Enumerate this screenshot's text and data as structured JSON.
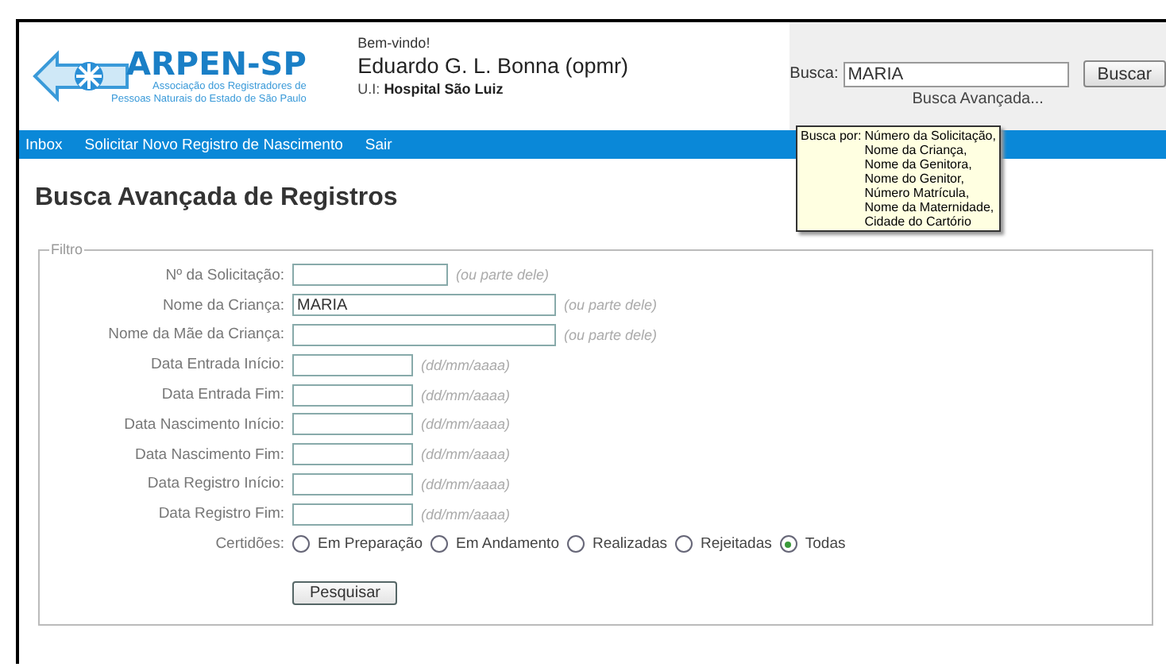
{
  "header": {
    "logo": {
      "name": "ARPEN-SP",
      "subtitle_lines": [
        "Associação dos Registradores de",
        "Pessoas Naturais do Estado de São Paulo"
      ]
    },
    "greeting": "Bem-vindo!",
    "user": "Eduardo G. L. Bonna (opmr)",
    "unit": "U.I: **Hospital São Luiz**"
  },
  "search": {
    "label": "Busca:",
    "value": "MARIA",
    "button": "Buscar",
    "advanced_link": "Busca Avançada..."
  },
  "tooltip": {
    "label": "Busca por:",
    "lines": [
      "Número da Solicitação,",
      "Nome da Criança,",
      "Nome da Genitora,",
      "Nome do Genitor,",
      "Número Matrícula,",
      "Nome da Maternidade,",
      "Cidade do Cartório"
    ]
  },
  "nav": [
    "Inbox",
    "Solicitar Novo Registro de Nascimento",
    "Sair"
  ],
  "page_title": "Busca Avançada de Registros",
  "filter": {
    "legend": "Filtro",
    "fields": [
      {
        "kind": "short",
        "label": "Nº da Solicitação:",
        "hint": "(ou parte dele)"
      },
      {
        "kind": "long",
        "label": "Nome da Criança:",
        "value": "MARIA",
        "hint": "(ou parte dele)"
      },
      {
        "kind": "long",
        "label": "Nome da Mãe da Criança:",
        "hint": "(ou parte dele)"
      },
      {
        "kind": "date",
        "label": "Data Entrada Início:",
        "hint": "(dd/mm/aaaa)"
      },
      {
        "kind": "date",
        "label": "Data Entrada Fim:",
        "hint": "(dd/mm/aaaa)"
      },
      {
        "kind": "date",
        "label": "Data Nascimento Início:",
        "hint": "(dd/mm/aaaa)"
      },
      {
        "kind": "date",
        "label": "Data Nascimento Fim:",
        "hint": "(dd/mm/aaaa)"
      },
      {
        "kind": "date",
        "label": "Data Registro Início:",
        "hint": "(dd/mm/aaaa)"
      },
      {
        "kind": "date",
        "label": "Data Registro Fim:",
        "hint": "(dd/mm/aaaa)"
      }
    ],
    "certidoes": {
      "label": "Certidões:",
      "options": [
        {
          "label": "Em Preparação",
          "selected": false
        },
        {
          "label": "Em Andamento",
          "selected": false
        },
        {
          "label": "Realizadas",
          "selected": false
        },
        {
          "label": "Rejeitadas",
          "selected": false
        },
        {
          "label": "Todas",
          "selected": true
        }
      ]
    },
    "button": "Pesquisar"
  }
}
